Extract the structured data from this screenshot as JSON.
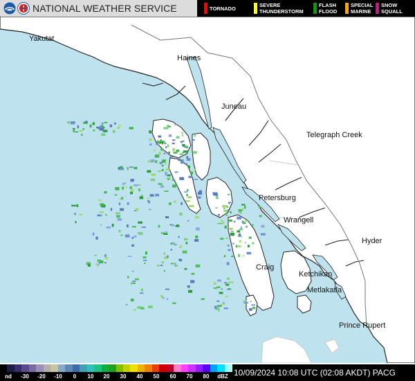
{
  "header": {
    "agency_name": "NATIONAL WEATHER SERVICE",
    "warning_legend": [
      {
        "label": "TORNADO",
        "color": "#ff0000"
      },
      {
        "label": "SEVERE\nTHUNDERSTORM",
        "color": "#ffff00"
      },
      {
        "label": "FLASH\nFLOOD",
        "color": "#00a000"
      },
      {
        "label": "SPECIAL\nMARINE",
        "color": "#ffa500"
      },
      {
        "label": "SNOW\nSQUALL",
        "color": "#c71585"
      }
    ]
  },
  "map": {
    "ocean_color": "#bfe3ee",
    "land_color": "#ffffff",
    "cities": [
      "Yakutat",
      "Haines",
      "Juneau",
      "Telegraph Creek",
      "Petersburg",
      "Wrangell",
      "Hyder",
      "Craig",
      "Ketchikan",
      "Metlakatla",
      "Prince Rupert"
    ]
  },
  "footer": {
    "scale_labels": [
      "nd",
      "-30",
      "-20",
      "-10",
      "0",
      "10",
      "20",
      "30",
      "40",
      "50",
      "60",
      "70",
      "80",
      "dBZ"
    ],
    "timestamp": "10/09/2024 10:08 UTC (02:08 AKDT) PACG"
  }
}
